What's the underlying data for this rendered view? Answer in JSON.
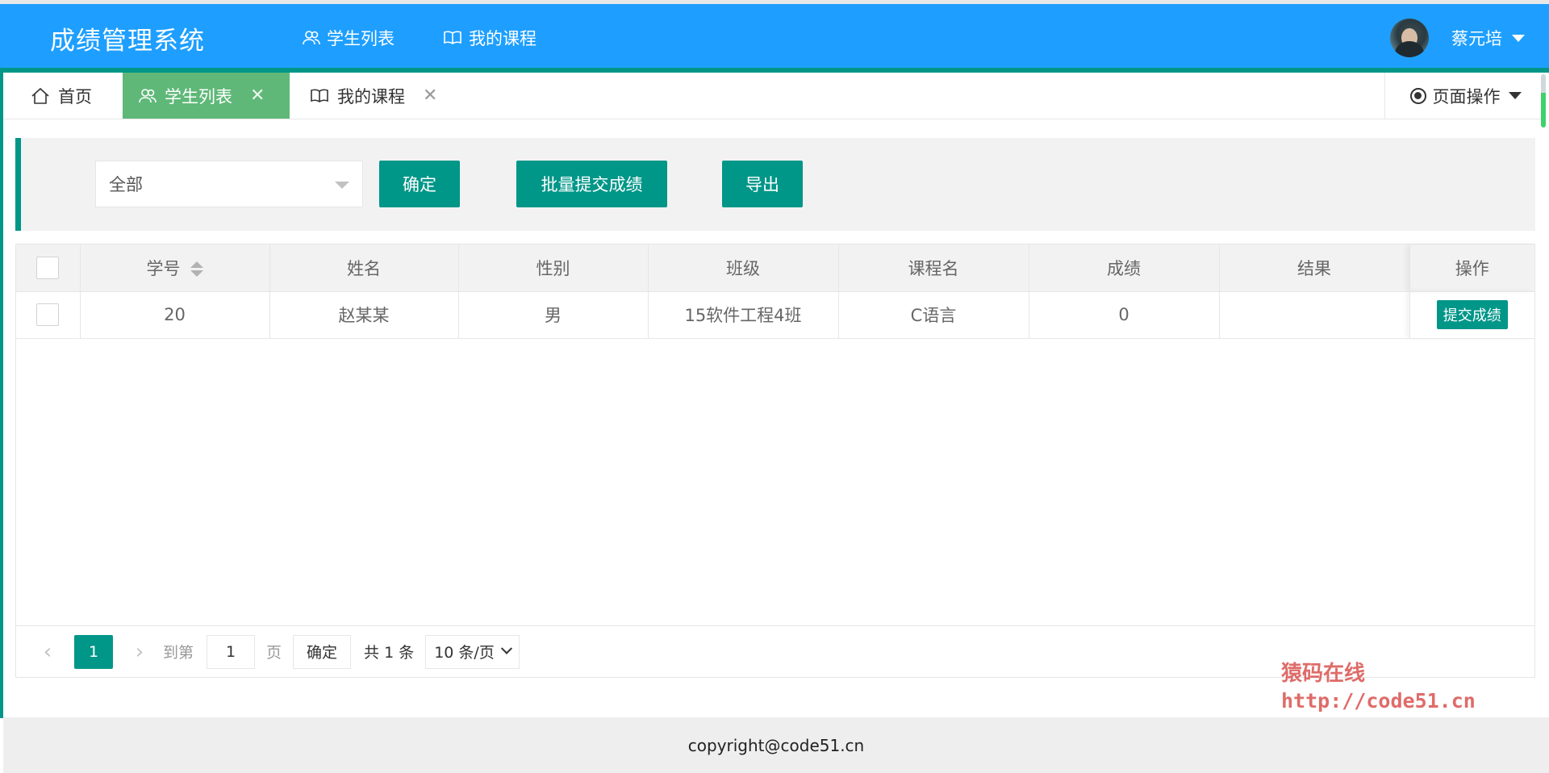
{
  "header": {
    "logo": "成绩管理系统",
    "nav": [
      {
        "label": "学生列表",
        "icon": "users-icon",
        "active": true
      },
      {
        "label": "我的课程",
        "icon": "book-icon",
        "active": false
      }
    ],
    "user_name": "蔡元培"
  },
  "tabs": [
    {
      "label": "首页",
      "icon": "home-icon",
      "closable": false
    },
    {
      "label": "学生列表",
      "icon": "users-icon",
      "closable": true,
      "active": true
    },
    {
      "label": "我的课程",
      "icon": "book-icon",
      "closable": true
    }
  ],
  "page_op": {
    "label": "页面操作"
  },
  "toolbar": {
    "select_value": "全部",
    "confirm_label": "确定",
    "batch_label": "批量提交成绩",
    "export_label": "导出"
  },
  "table": {
    "columns": [
      "学号",
      "姓名",
      "性别",
      "班级",
      "课程名",
      "成绩",
      "结果",
      "操作"
    ],
    "rows": [
      {
        "id": "20",
        "name": "赵某某",
        "gender": "男",
        "class": "15软件工程4班",
        "course": "C语言",
        "score": "0",
        "result": "",
        "action": "提交成绩"
      }
    ]
  },
  "pager": {
    "current": "1",
    "goto_label": "到第",
    "goto_value": "1",
    "page_label": "页",
    "confirm_label": "确定",
    "total_label": "共 1 条",
    "page_size": "10 条/页"
  },
  "watermark": {
    "line1": "猿码在线",
    "line2": "http://code51.cn"
  },
  "footer": {
    "copyright": "copyright@code51.cn"
  },
  "colors": {
    "header": "#1e9fff",
    "primary": "#009688",
    "tab_active": "#5fb878"
  }
}
